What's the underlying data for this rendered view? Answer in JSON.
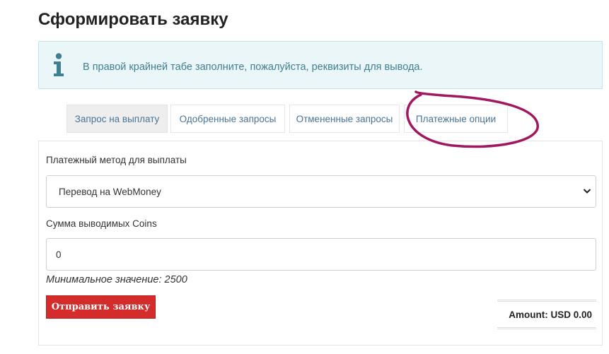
{
  "page": {
    "title": "Сформировать заявку"
  },
  "info": {
    "icon": "info-icon",
    "message": "В правой крайней табе заполните, пожалуйста, реквизиты для вывода."
  },
  "tabs": [
    {
      "label": "Запрос на выплату",
      "active": true
    },
    {
      "label": "Одобренные запросы",
      "active": false
    },
    {
      "label": "Отмененные запросы",
      "active": false
    },
    {
      "label": "Платежные опции",
      "active": false
    }
  ],
  "form": {
    "method_label": "Платежный метод для выплаты",
    "method_value": "Перевод на WebMoney",
    "amount_label": "Сумма выводимых Coins",
    "amount_value": "0",
    "min_hint": "Минимальное значение: 2500",
    "submit_label": "Отправить заявку",
    "total": "Amount:  USD 0.00"
  },
  "colors": {
    "accent_red": "#d42b2b",
    "info_bg": "#eaf6f8",
    "info_text": "#3f7f8f",
    "tab_text": "#4a7496",
    "annotation": "#a0185f"
  }
}
